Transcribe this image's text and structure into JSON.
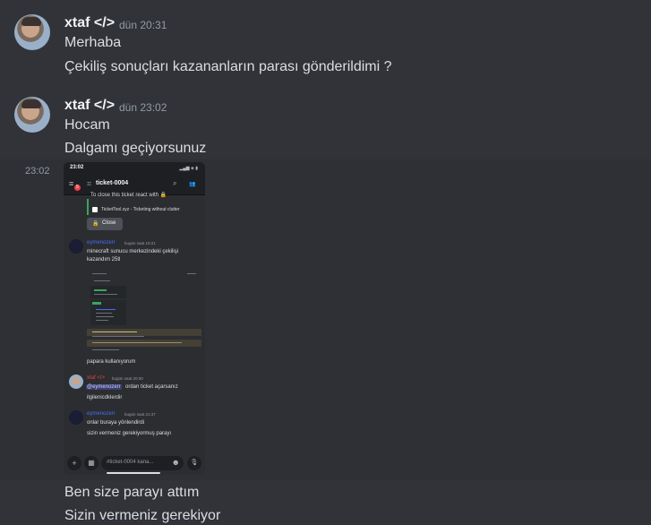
{
  "messages": [
    {
      "username": "xtaf </>",
      "timestamp": "dün 20:31",
      "lines": [
        "Merhaba",
        "Çekiliş sonuçları kazananların parası gönderildimi ?"
      ]
    },
    {
      "username": "xtaf </>",
      "timestamp": "dün 23:02",
      "lines": [
        "Hocam",
        "Dalgamı geçiyorsunuz"
      ]
    }
  ],
  "attachment": {
    "side_timestamp": "23:02",
    "screenshot": {
      "status_time": "23:02",
      "status_icons": "▂▄▆ ◈ ▮",
      "badge": "5",
      "channel": "ticket-0004",
      "embed_text": "To close this ticket react with 🔒",
      "embed_footer": "TicketTool.xyz - Ticketing without clutter",
      "close_label": "Close",
      "msg1": {
        "username": "eymenozerr",
        "timestamp": "bugün saat 19:21",
        "lines": [
          "minecraft sunucu merkezindeki çekilişi",
          "kazandım 25tl"
        ],
        "after_image": "papara kullanıyorum"
      },
      "msg2": {
        "username": "xtaf </>",
        "timestamp": "bugün saat 20:30",
        "mention": "@eymenozerr",
        "line1_rest": " ordan ticket açarsanız",
        "line2": "ilgilenicdklerdir"
      },
      "msg3": {
        "username": "eymenozerr",
        "timestamp": "bugün saat 21:37",
        "lines": [
          "onlar buraya yönlendirdi",
          "sizin vermeniz gerekiyormuş parayı"
        ]
      },
      "input_placeholder": "#ticket-0004 kana...",
      "icons": {
        "plus": "+",
        "gift": "▦",
        "emoji": "☻",
        "mic": "🎙",
        "search": "⌕",
        "members": "👥"
      }
    }
  },
  "trailing_lines": [
    "Ben size parayı attım",
    "Sizin vermeniz gerekiyor"
  ],
  "colors": {
    "background": "#313338",
    "text": "#dbdee1",
    "username": "#f2f3f5",
    "timestamp": "#949ba4",
    "mention_blue": "#4a6cf7",
    "red_name": "#e0433d",
    "green_embed": "#3ba55d"
  }
}
